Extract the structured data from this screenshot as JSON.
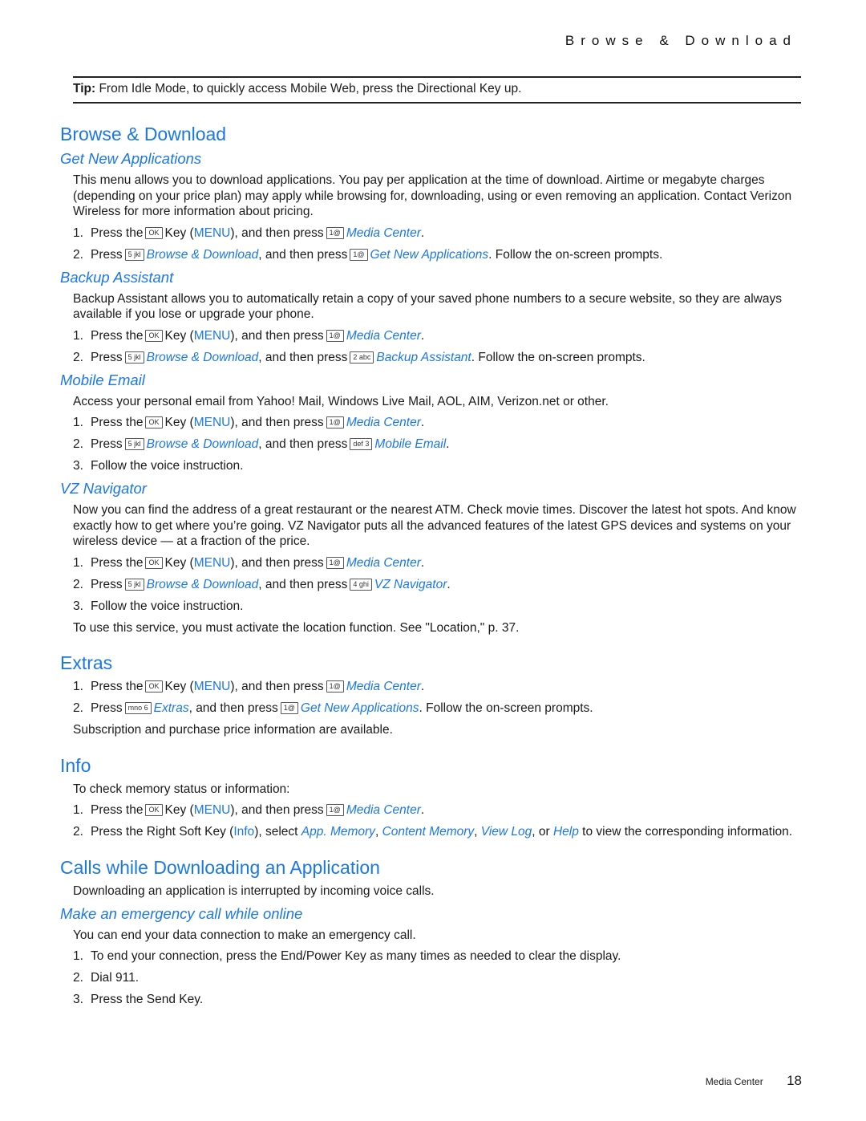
{
  "running_head": "Browse & Download",
  "tip": {
    "label": "Tip:",
    "text": "From Idle Mode, to quickly access Mobile Web, press the Directional Key up."
  },
  "keys": {
    "ok": "OK",
    "k1": "1@",
    "k2": "2 abc",
    "k3": "def 3",
    "k4": "4 ghi",
    "k5": "5 jkl",
    "k6": "mno 6"
  },
  "common": {
    "press_the": "Press the",
    "press": "Press",
    "key_menu_pre": "Key (",
    "menu": "MENU",
    "and_then_press": "), and then press",
    "and_then_press2": ", and then press",
    "media_center": "Media Center",
    "period": ".",
    "browse_download": "Browse & Download",
    "follow": ". Follow the on-screen prompts.",
    "voice": "Follow the voice instruction."
  },
  "sections": {
    "browse": {
      "title": "Browse & Download",
      "get_new": {
        "title": "Get New Applications",
        "body": "This menu allows you to download applications. You pay per application at the time of download. Airtime or megabyte charges (depending on your price plan) may apply while browsing for, downloading, using or even removing an application. Contact Verizon Wireless for more information about pricing.",
        "target": "Get New Applications"
      },
      "backup": {
        "title": "Backup Assistant",
        "body": "Backup Assistant allows you to automatically retain a copy of your saved phone numbers to a secure website, so they are always available if you lose or upgrade your phone.",
        "target": "Backup Assistant"
      },
      "email": {
        "title": "Mobile Email",
        "body": "Access your personal email from Yahoo! Mail, Windows Live Mail, AOL, AIM, Verizon.net or other.",
        "target": "Mobile Email"
      },
      "vz": {
        "title": "VZ Navigator",
        "body": "Now you can find the address of a great restaurant or the nearest ATM. Check movie times. Discover the latest hot spots. And know exactly how to get where you’re going. VZ Navigator puts all the advanced features of the latest GPS devices and systems on your wireless device — at a fraction of the price.",
        "target": "VZ Navigator",
        "note": "To use this service, you must activate the location function. See \"Location,\" p. 37."
      }
    },
    "extras": {
      "title": "Extras",
      "link": "Extras",
      "target": "Get New Applications",
      "note": "Subscription and purchase price information are available."
    },
    "info": {
      "title": "Info",
      "intro": "To check memory status or information:",
      "s2_pre": "Press the Right Soft Key (",
      "s2_info": "Info",
      "s2_mid": "), select",
      "app_memory": "App. Memory",
      "content_memory": "Content Memory",
      "view_log": "View Log",
      "or": ", or",
      "help": "Help",
      "s2_post": "to view the corresponding information."
    },
    "calls": {
      "title": "Calls while Downloading an Application",
      "body": "Downloading an application is interrupted by incoming voice calls.",
      "sub_title": "Make an emergency call while online",
      "sub_body": "You can end your data connection to make an emergency call.",
      "steps": [
        "To end your connection, press the End/Power Key as many times as needed to clear the display.",
        "Dial 911.",
        "Press the Send Key."
      ]
    }
  },
  "footer": {
    "section": "Media Center",
    "page": "18"
  }
}
